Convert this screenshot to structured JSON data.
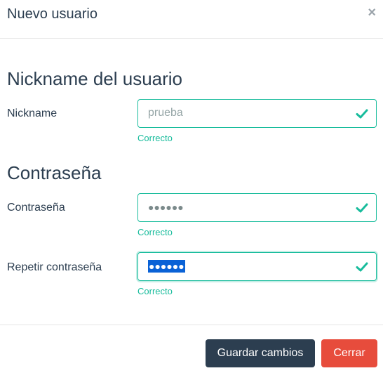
{
  "header": {
    "title": "Nuevo usuario",
    "close_glyph": "×"
  },
  "sections": {
    "nickname": {
      "title": "Nickname del usuario",
      "label": "Nickname",
      "value": "prueba",
      "help": "Correcto"
    },
    "password": {
      "title": "Contraseña",
      "label": "Contraseña",
      "value": "●●●●●●",
      "help": "Correcto",
      "repeat_label": "Repetir contraseña",
      "repeat_value": "●●●●●●",
      "repeat_help": "Correcto"
    }
  },
  "footer": {
    "save_label": "Guardar cambios",
    "close_label": "Cerrar"
  },
  "colors": {
    "success": "#18bc9c",
    "primary": "#2c3e50",
    "danger": "#e74c3c"
  }
}
